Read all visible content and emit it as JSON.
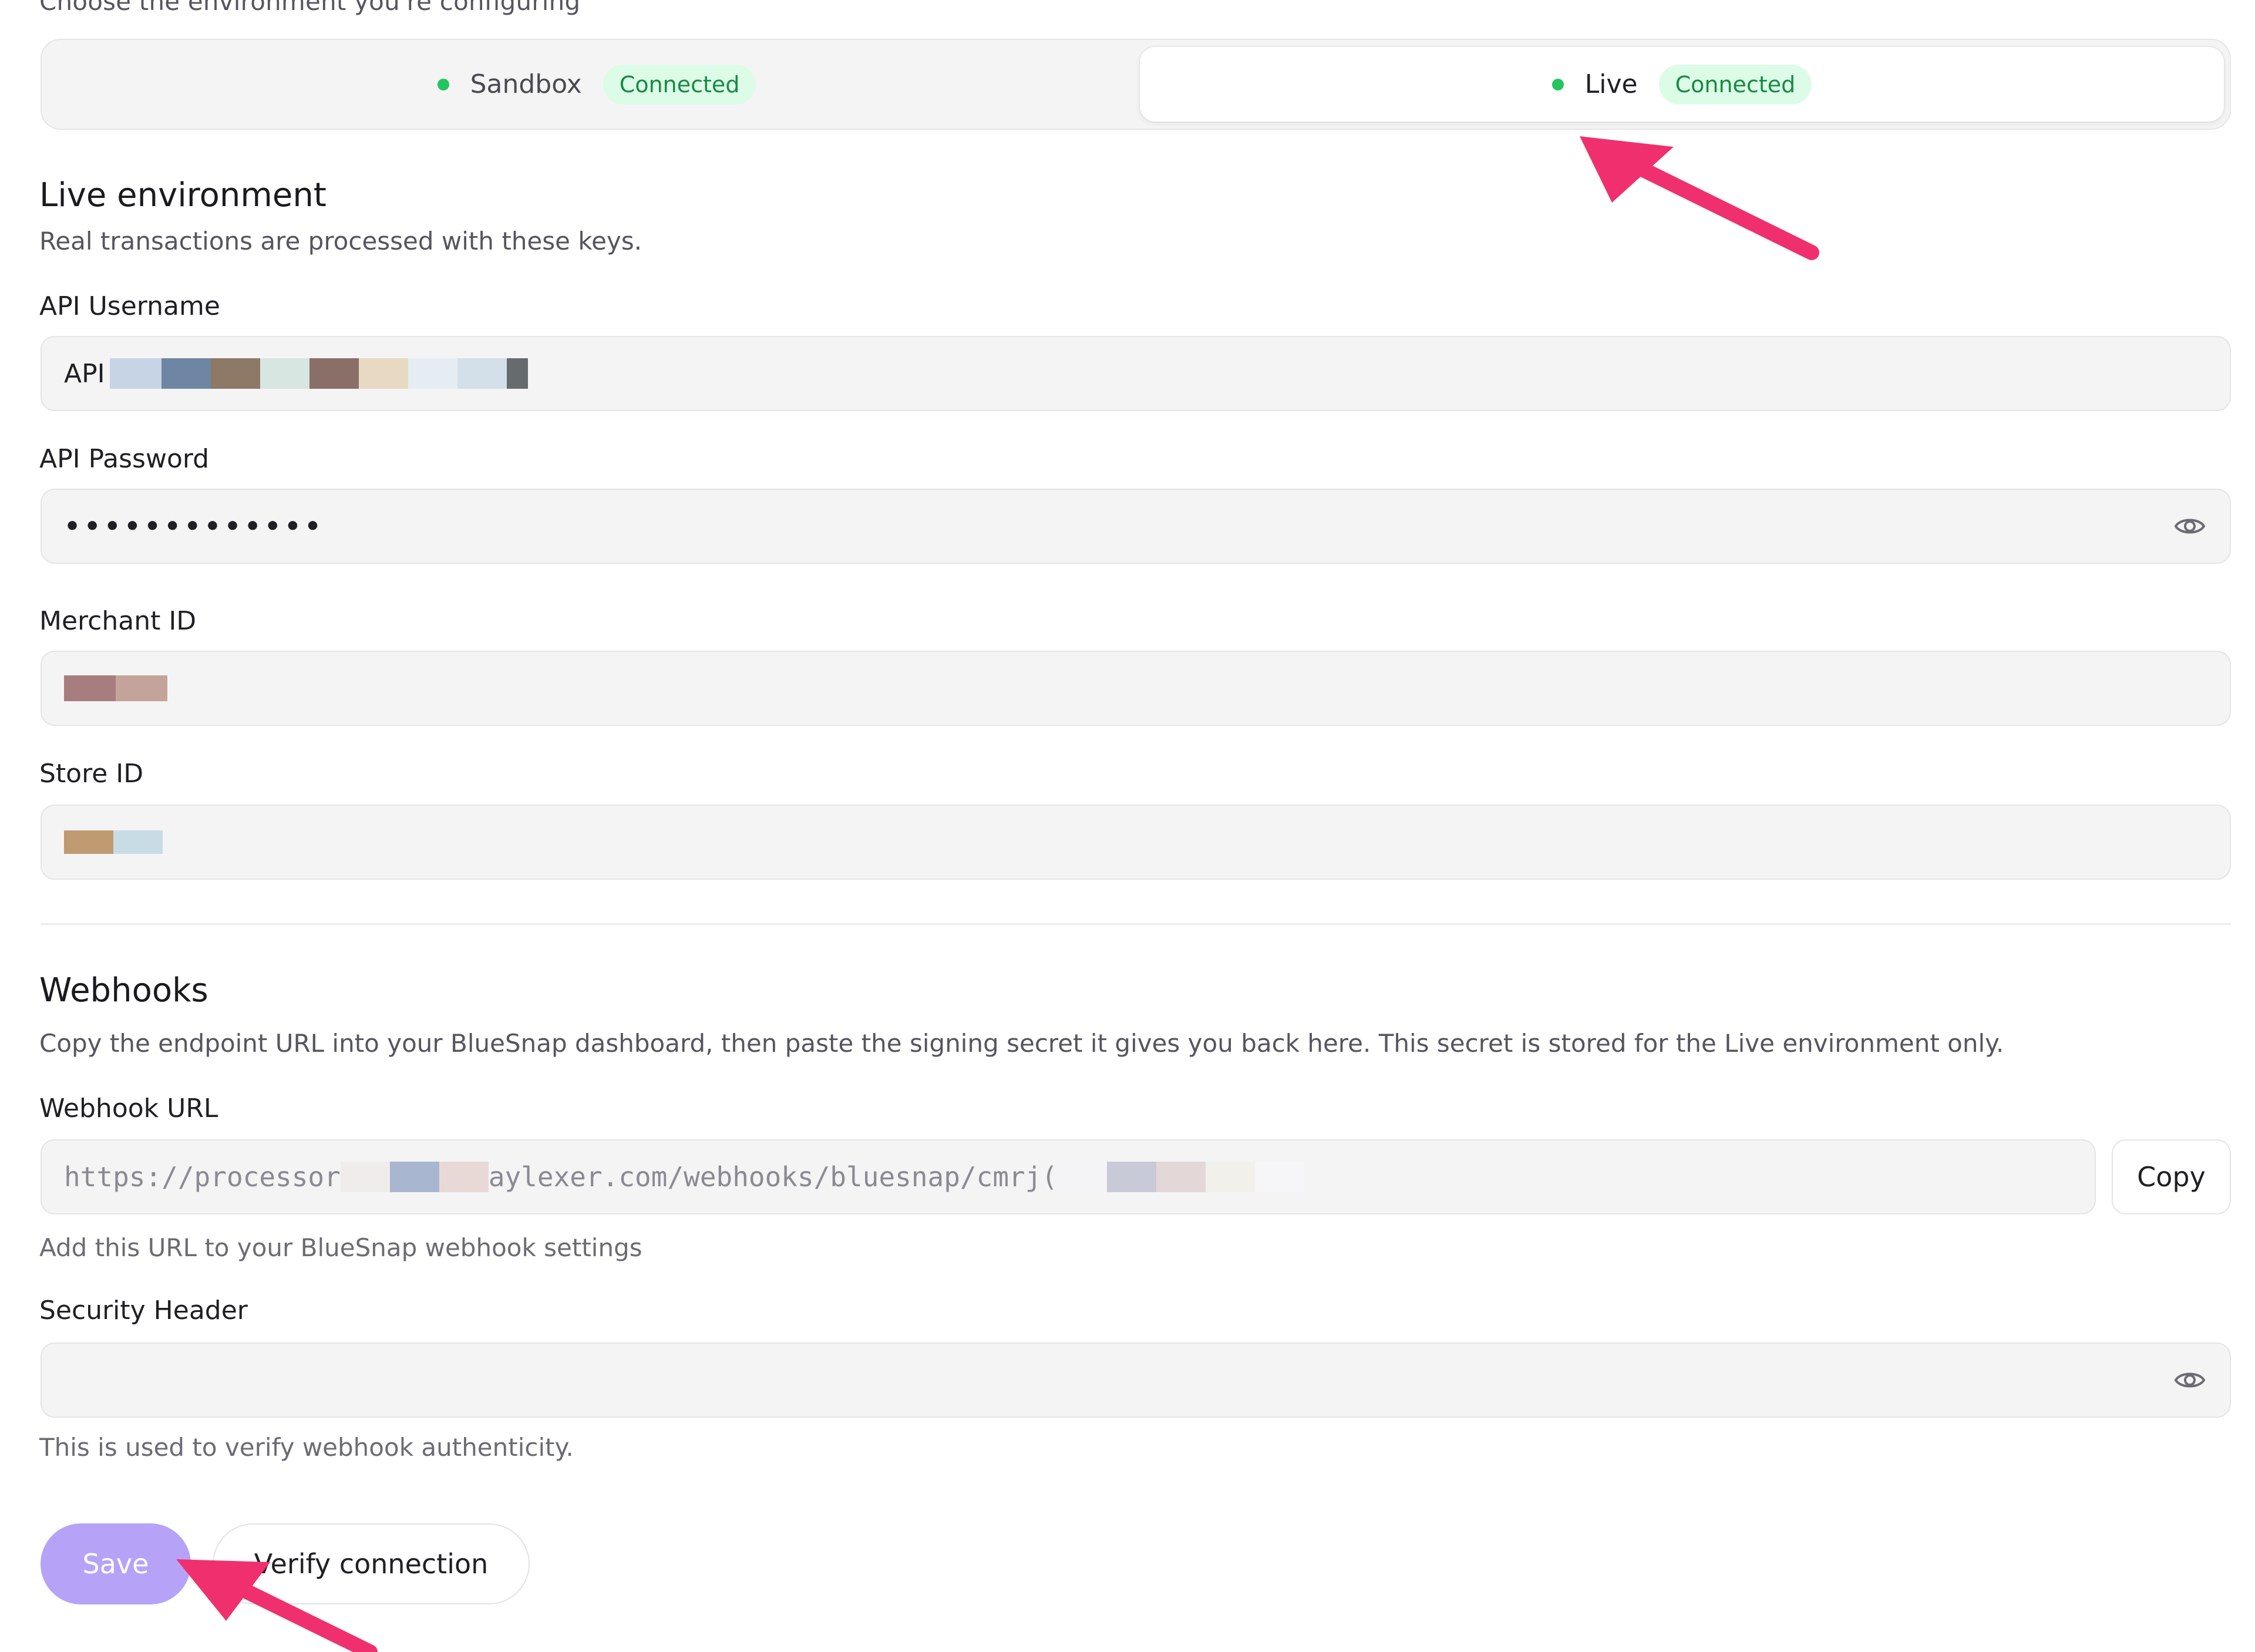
{
  "environment": {
    "hint": "Choose the environment you're configuring",
    "options": [
      {
        "label": "Sandbox",
        "badge": "Connected",
        "selected": false
      },
      {
        "label": "Live",
        "badge": "Connected",
        "selected": true
      }
    ],
    "status_color": "#22c55e"
  },
  "live": {
    "title": "Live environment",
    "description": "Real transactions are processed with these keys."
  },
  "fields": {
    "api_username": {
      "label": "API Username",
      "value_prefix": "API"
    },
    "api_password": {
      "label": "API Password",
      "value": "•••••••••••••"
    },
    "merchant_id": {
      "label": "Merchant ID"
    },
    "store_id": {
      "label": "Store ID"
    }
  },
  "webhooks": {
    "title": "Webhooks",
    "description": "Copy the endpoint URL into your BlueSnap dashboard, then paste the signing secret it gives you back here. This secret is stored for the Live environment only.",
    "url_label": "Webhook URL",
    "url_part1": "https://processor",
    "url_part2": "aylexer.com/webhooks/bluesnap/cmrj(",
    "copy_label": "Copy",
    "url_help": "Add this URL to your BlueSnap webhook settings",
    "security_label": "Security Header",
    "security_help": "This is used to verify webhook authenticity."
  },
  "actions": {
    "save_label": "Save",
    "verify_label": "Verify connection"
  },
  "colors": {
    "accent": "#b6a3f7",
    "annotation_arrow": "#f0306e",
    "badge_bg": "#dcfce7",
    "badge_text": "#178a43"
  }
}
